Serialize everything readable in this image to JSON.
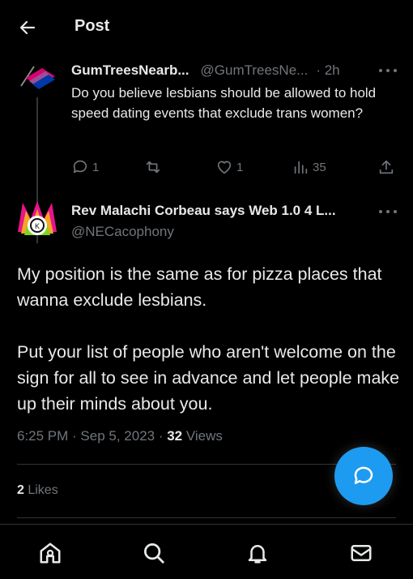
{
  "header": {
    "title": "Post",
    "back_icon": "arrow-left-icon"
  },
  "reply": {
    "display_name": "GumTreesNearb...",
    "handle": "@GumTreesNe...",
    "time": "· 2h",
    "text": "Do you believe lesbians should be allowed to hold speed dating events that exclude trans women?",
    "replies": "1",
    "retweets": "",
    "likes": "1",
    "views": "35"
  },
  "post": {
    "display_name": "Rev Malachi Corbeau says Web 1.0 4 L...",
    "handle": "@NECacophony",
    "paragraph1": "My position is the same as for pizza places that wanna exclude lesbians.",
    "paragraph2": "Put your list of people who aren't welcome on the sign for all to see in advance and let people make up their minds about you.",
    "timestamp": "6:25 PM · Sep 5, 2023 · ",
    "views_count": "32",
    "views_label": " Views",
    "likes_count": "2",
    "likes_label": " Likes"
  },
  "fab": {
    "icon": "compose-reply-icon"
  },
  "nav": {
    "items": [
      "home-icon",
      "search-icon",
      "notifications-icon",
      "messages-icon"
    ]
  },
  "colors": {
    "background": "#000000",
    "text_primary": "#e7e9ea",
    "text_secondary": "#71767b",
    "accent": "#1d9bf0",
    "divider": "#2f3336"
  }
}
